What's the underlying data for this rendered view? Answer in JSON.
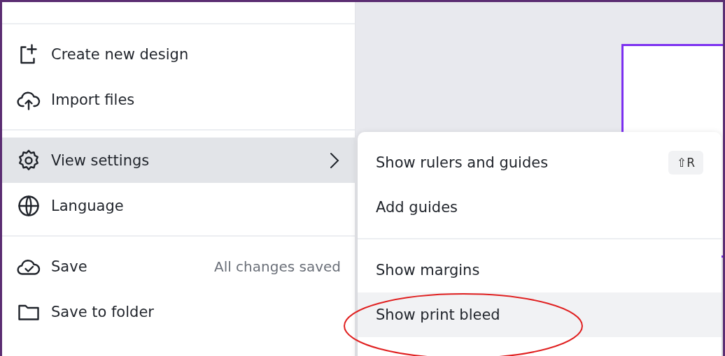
{
  "menu": {
    "sections": [
      {
        "items": [
          {
            "label": "Create new design",
            "selected": false
          },
          {
            "label": "Import files",
            "selected": false
          }
        ]
      },
      {
        "items": [
          {
            "label": "View settings",
            "selected": true,
            "submenu": true
          },
          {
            "label": "Language",
            "selected": false
          }
        ]
      },
      {
        "items": [
          {
            "label": "Save",
            "selected": false,
            "status": "All changes saved"
          },
          {
            "label": "Save to folder",
            "selected": false
          }
        ]
      }
    ]
  },
  "submenu": {
    "sections": [
      {
        "items": [
          {
            "label": "Show rulers and guides",
            "selected": false,
            "shortcut": "⇧R"
          },
          {
            "label": "Add guides",
            "selected": false
          }
        ]
      },
      {
        "items": [
          {
            "label": "Show margins",
            "selected": false
          },
          {
            "label": "Show print bleed",
            "selected": true
          }
        ]
      }
    ]
  }
}
